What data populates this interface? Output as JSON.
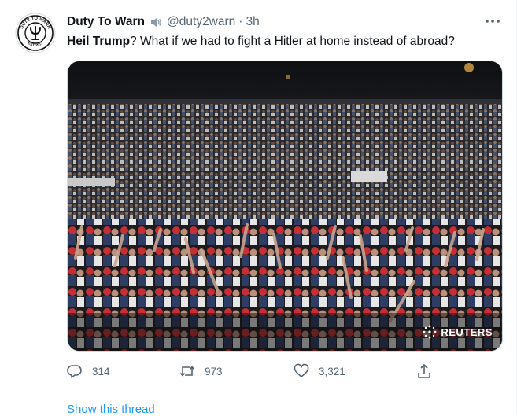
{
  "tweet": {
    "display_name": "Duty To Warn",
    "handle": "@duty2warn",
    "separator": "·",
    "time": "3h",
    "text_bold": "Heil Trump",
    "text_rest": "? What if we had to fight a Hitler at home instead of abroad?",
    "avatar": {
      "top_text": "DUTY TO WARN",
      "bottom_text": "EST. 2017",
      "icon": "psi-symbol-icon"
    },
    "media": {
      "watermark": "REUTERS",
      "description_icon": "photo"
    },
    "actions": {
      "reply_count": "314",
      "retweet_count": "973",
      "like_count": "3,321"
    },
    "show_thread": "Show this thread"
  },
  "colors": {
    "text": "#0f1419",
    "secondary": "#536471",
    "link": "#1d9bf0",
    "border": "#cfd9de"
  }
}
